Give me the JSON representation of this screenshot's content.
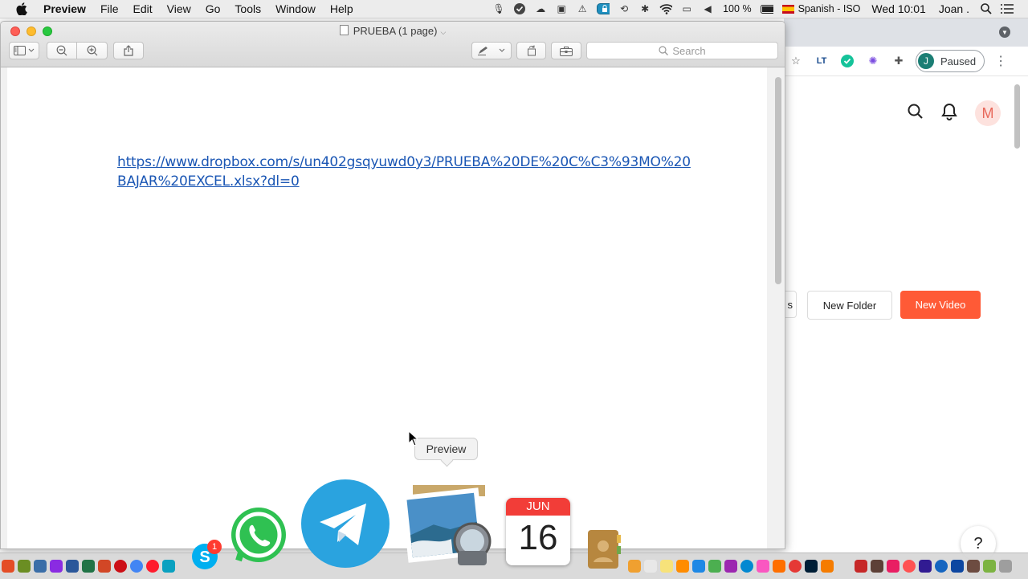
{
  "menubar": {
    "app_name": "Preview",
    "menus": [
      "File",
      "Edit",
      "View",
      "Go",
      "Tools",
      "Window",
      "Help"
    ],
    "battery": "100 %",
    "input_source": "Spanish - ISO",
    "clock": "Wed 10:01",
    "user": "Joan ."
  },
  "preview_window": {
    "title": "PRUEBA (1 page)",
    "search_placeholder": "Search",
    "link_line1": "https://www.dropbox.com/s/un402gsqyuwd0y3/PRUEBA%20DE%20C%C3%93MO%20",
    "link_line2": "BAJAR%20EXCEL.xlsx?dl=0"
  },
  "browser": {
    "profile_initial": "J",
    "profile_status": "Paused",
    "avatar_initial": "M",
    "partial_button": "s",
    "new_folder_label": "New Folder",
    "new_video_label": "New Video",
    "help_label": "?"
  },
  "tooltip": {
    "label": "Preview"
  },
  "dock": {
    "skype_badge": "1",
    "calendar_month": "JUN",
    "calendar_day": "16"
  },
  "colors": {
    "accent_orange": "#ff5a36",
    "link_blue": "#1a56b4",
    "telegram_blue": "#2aa3df",
    "whatsapp_green": "#2fc152"
  }
}
